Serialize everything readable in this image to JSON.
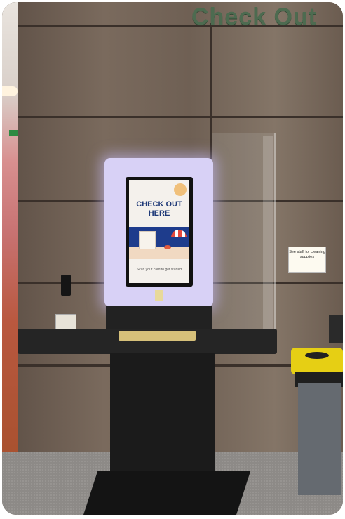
{
  "wall_sign": {
    "text": "Check Out"
  },
  "kiosk_display": {
    "title_line1": "CHECK OUT",
    "title_line2": "HERE",
    "subtitle": "Scan your card to get started"
  },
  "wall_sticker": {
    "text": "See staff for cleaning supplies"
  },
  "colors": {
    "kiosk_glow": "#d8d1f6",
    "display_title": "#1f3a78",
    "bin_lid": "#e6cf14",
    "sign_green": "#4d6b50"
  }
}
